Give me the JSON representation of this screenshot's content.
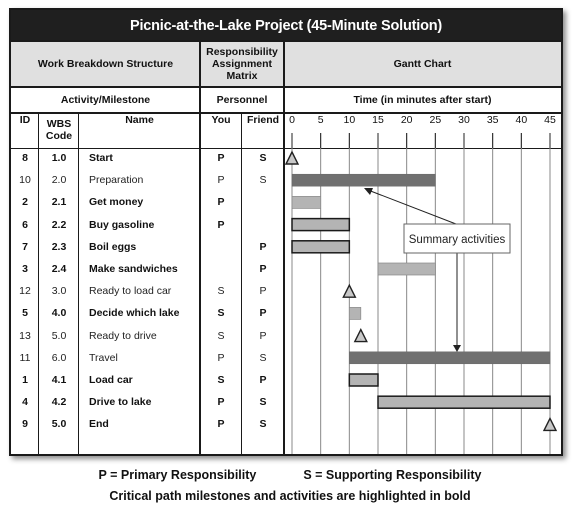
{
  "title": "Picnic-at-the-Lake Project (45-Minute Solution)",
  "headers": {
    "wbs": "Work Breakdown Structure",
    "ram": "Responsibility Assignment Matrix",
    "gantt": "Gantt Chart",
    "activity": "Activity/Milestone",
    "personnel": "Personnel",
    "time": "Time (in minutes after start)",
    "id": "ID",
    "wbs_code": "WBS Code",
    "name": "Name",
    "you": "You",
    "friend": "Friend"
  },
  "callout": "Summary activities",
  "legend": {
    "primary": "P = Primary Responsibility",
    "supporting": "S = Supporting Responsibility",
    "critical_note": "Critical path milestones and activities are highlighted in bold"
  },
  "colors": {
    "summary_bar": "#707070",
    "task_bar": "#b4b4b4",
    "milestone": "#c8c8c8",
    "header_grey": "#e0e0e0",
    "title_bg": "#1f1f1f"
  },
  "chart_data": {
    "type": "gantt",
    "title": "Gantt Chart",
    "xlabel": "Time (in minutes after start)",
    "xlim": [
      0,
      45
    ],
    "x_ticks": [
      0,
      5,
      10,
      15,
      20,
      25,
      30,
      35,
      40,
      45
    ],
    "grid": true,
    "rows": [
      {
        "id": "8",
        "wbs": "1.0",
        "name": "Start",
        "you": "P",
        "friend": "S",
        "critical": true,
        "kind": "milestone",
        "start": 0,
        "end": 0
      },
      {
        "id": "10",
        "wbs": "2.0",
        "name": "Preparation",
        "you": "P",
        "friend": "S",
        "critical": false,
        "kind": "summary",
        "start": 0,
        "end": 25
      },
      {
        "id": "2",
        "wbs": "2.1",
        "name": "Get money",
        "you": "P",
        "friend": "",
        "critical": true,
        "kind": "task",
        "start": 0,
        "end": 5,
        "outlined": false
      },
      {
        "id": "6",
        "wbs": "2.2",
        "name": "Buy gasoline",
        "you": "P",
        "friend": "",
        "critical": true,
        "kind": "task",
        "start": 0,
        "end": 10,
        "outlined": true
      },
      {
        "id": "7",
        "wbs": "2.3",
        "name": "Boil eggs",
        "you": "",
        "friend": "P",
        "critical": true,
        "kind": "task",
        "start": 0,
        "end": 10,
        "outlined": true
      },
      {
        "id": "3",
        "wbs": "2.4",
        "name": "Make sandwiches",
        "you": "",
        "friend": "P",
        "critical": true,
        "kind": "task",
        "start": 15,
        "end": 25,
        "outlined": false
      },
      {
        "id": "12",
        "wbs": "3.0",
        "name": "Ready to load car",
        "you": "S",
        "friend": "P",
        "critical": false,
        "kind": "milestone",
        "start": 10,
        "end": 10
      },
      {
        "id": "5",
        "wbs": "4.0",
        "name": "Decide which lake",
        "you": "S",
        "friend": "P",
        "critical": true,
        "kind": "task",
        "start": 10,
        "end": 12,
        "outlined": false
      },
      {
        "id": "13",
        "wbs": "5.0",
        "name": "Ready to drive",
        "you": "S",
        "friend": "P",
        "critical": false,
        "kind": "milestone",
        "start": 12,
        "end": 12
      },
      {
        "id": "11",
        "wbs": "6.0",
        "name": "Travel",
        "you": "P",
        "friend": "S",
        "critical": false,
        "kind": "summary",
        "start": 10,
        "end": 45
      },
      {
        "id": "1",
        "wbs": "4.1",
        "name": "Load car",
        "you": "S",
        "friend": "P",
        "critical": true,
        "kind": "task",
        "start": 10,
        "end": 15,
        "outlined": true
      },
      {
        "id": "4",
        "wbs": "4.2",
        "name": "Drive to lake",
        "you": "P",
        "friend": "S",
        "critical": true,
        "kind": "task",
        "start": 15,
        "end": 45,
        "outlined": true
      },
      {
        "id": "9",
        "wbs": "5.0",
        "name": "End",
        "you": "P",
        "friend": "S",
        "critical": true,
        "kind": "milestone",
        "start": 45,
        "end": 45
      }
    ]
  }
}
